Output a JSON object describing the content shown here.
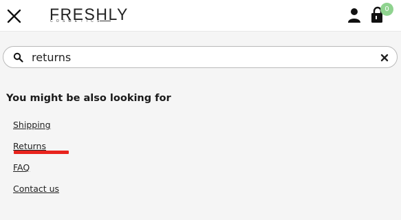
{
  "header": {
    "logo_text": "FRESHLY",
    "logo_subtext": "COSMETICS",
    "cart_count": "0",
    "icons": {
      "close": "close-icon",
      "account": "user-icon",
      "cart": "shopping-bag-icon"
    }
  },
  "search": {
    "value": "returns",
    "icon": "search-icon",
    "clear_icon": "clear-icon"
  },
  "suggestions": {
    "title": "You might be also looking for",
    "links": [
      {
        "label": "Shipping"
      },
      {
        "label": "Returns",
        "highlighted": true
      },
      {
        "label": "FAQ"
      },
      {
        "label": "Contact us"
      }
    ]
  },
  "colors": {
    "highlight": "#e8231d",
    "badge": "#8fd38f",
    "background": "#f5f5f5"
  }
}
